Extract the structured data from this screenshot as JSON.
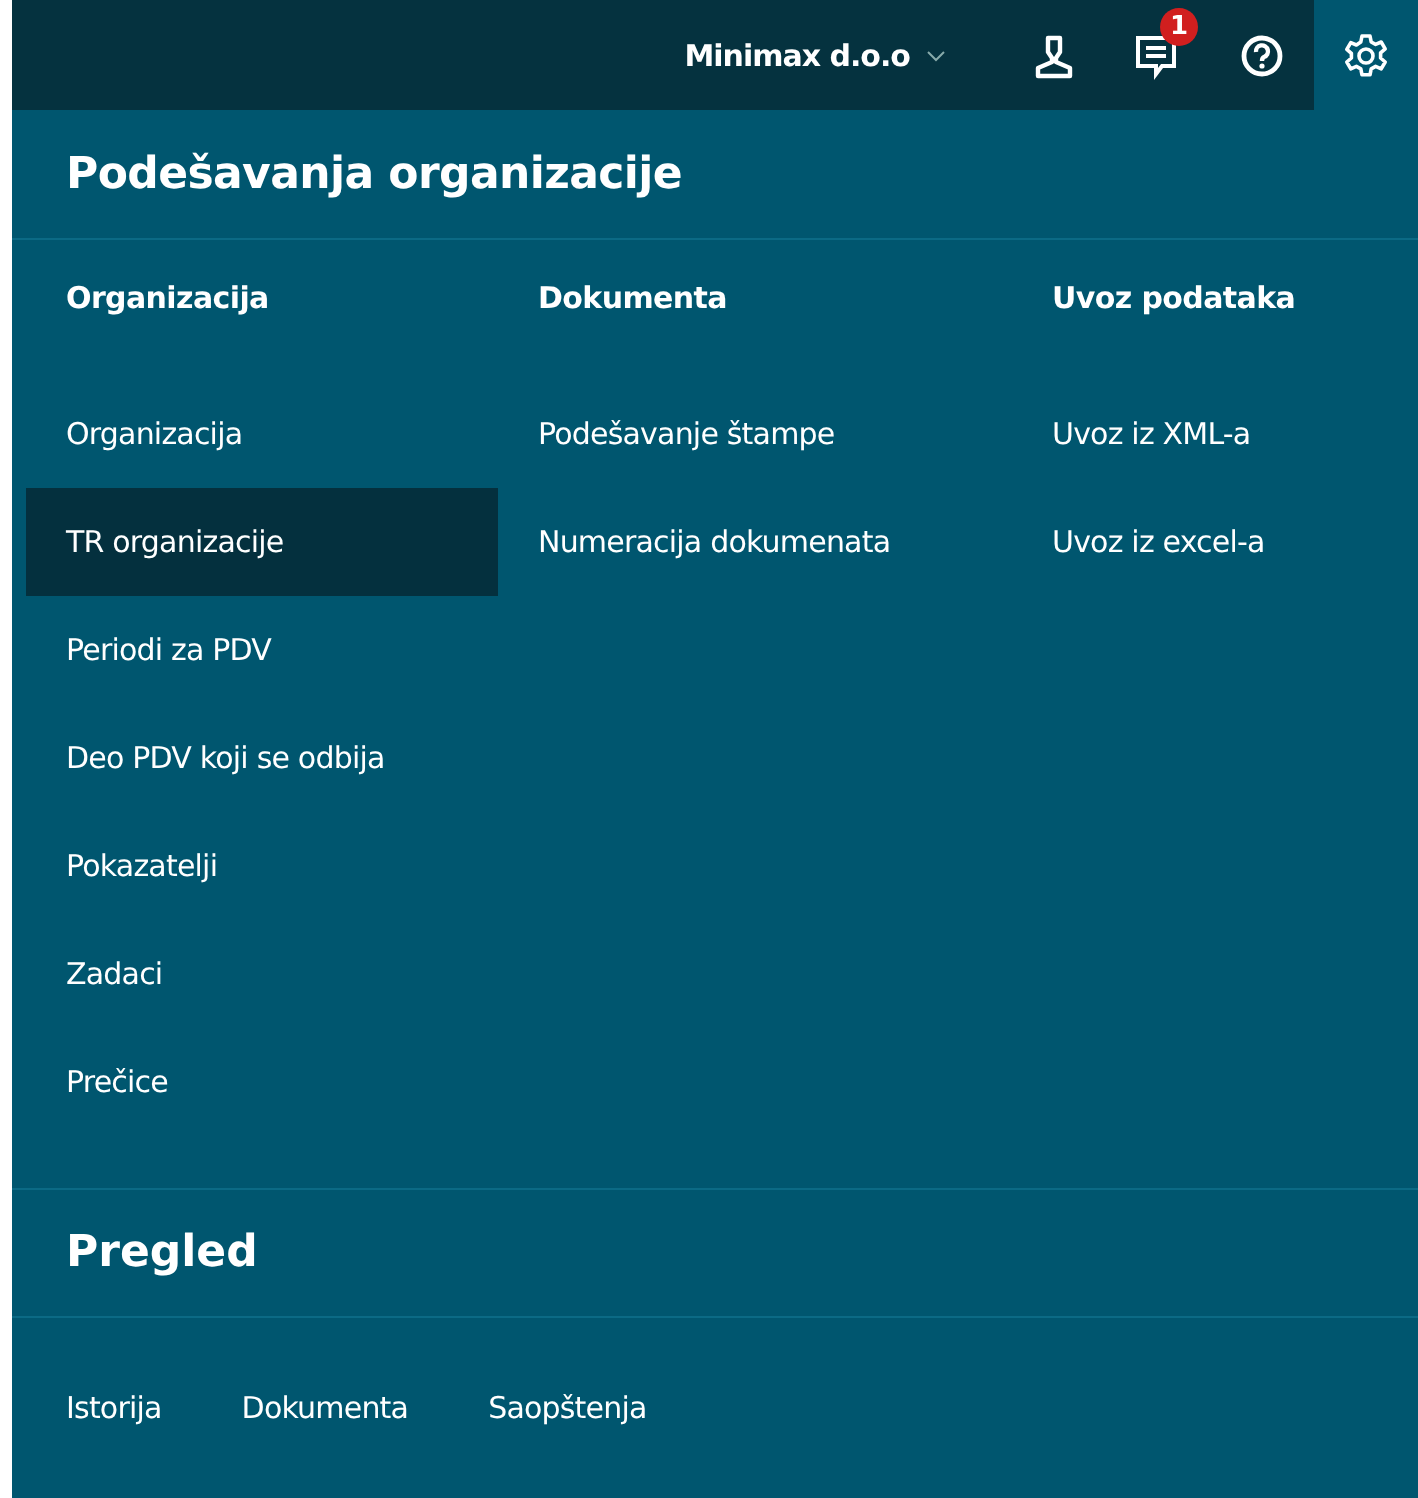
{
  "top_bar": {
    "company": "Minimax d.o.o",
    "notification_count": "1",
    "settings_selected": true
  },
  "settings": {
    "title": "Podešavanja organizacije",
    "columns": [
      {
        "heading": "Organizacija",
        "items": [
          {
            "label": "Organizacija",
            "selected": false
          },
          {
            "label": "TR organizacije",
            "selected": true
          },
          {
            "label": "Periodi za PDV",
            "selected": false
          },
          {
            "label": "Deo PDV koji se odbija",
            "selected": false
          },
          {
            "label": "Pokazatelji",
            "selected": false
          },
          {
            "label": "Zadaci",
            "selected": false
          },
          {
            "label": "Prečice",
            "selected": false
          }
        ]
      },
      {
        "heading": "Dokumenta",
        "items": [
          {
            "label": "Podešavanje štampe",
            "selected": false
          },
          {
            "label": "Numeracija dokumenata",
            "selected": false
          }
        ]
      },
      {
        "heading": "Uvoz podataka",
        "items": [
          {
            "label": "Uvoz iz XML-a",
            "selected": false
          },
          {
            "label": "Uvoz iz excel-a",
            "selected": false
          }
        ]
      }
    ]
  },
  "overview": {
    "title": "Pregled",
    "links": [
      "Istorija",
      "Dokumenta",
      "Saopštenja"
    ]
  }
}
